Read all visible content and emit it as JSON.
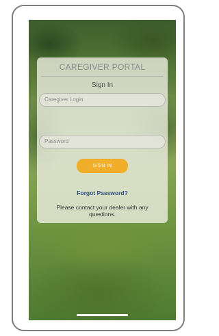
{
  "portal": {
    "title": "CAREGIVER PORTAL",
    "heading": "Sign In"
  },
  "form": {
    "login_placeholder": "Caregiver Login",
    "password_placeholder": "Password",
    "signin_label": "SIGN IN"
  },
  "links": {
    "forgot_password": "Forgot Password?"
  },
  "footer": {
    "contact_text": "Please contact your dealer with any questions."
  },
  "colors": {
    "accent": "#f0ae2a",
    "link": "#2f4f87"
  }
}
